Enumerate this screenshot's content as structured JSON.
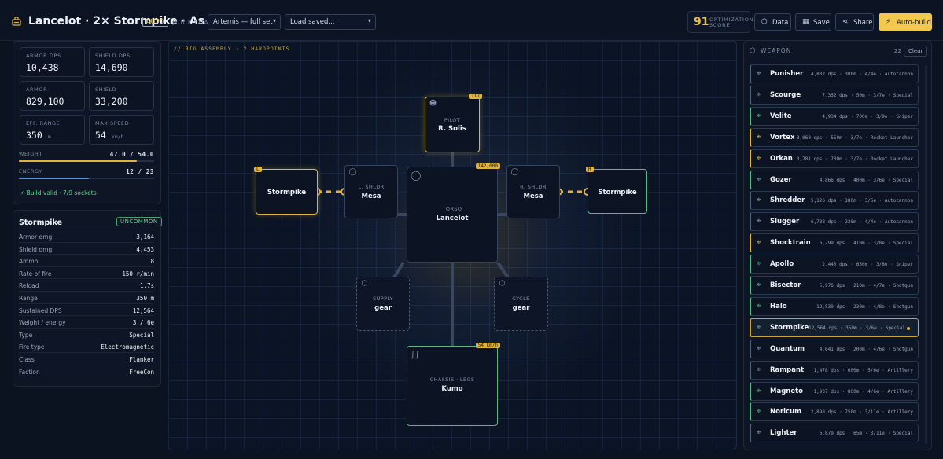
{
  "header": {
    "build_title": "Lancelot · 2× Stormpike · As",
    "auto_label": "AUTO",
    "quick_load_label": "QUICK-LOAD",
    "preset_value": "Artemis — full set",
    "load_placeholder": "Load saved...",
    "score_value": "91",
    "score_label_1": "OPTIMIZATION",
    "score_label_2": "SCORE",
    "data_label": "Data",
    "save_label": "Save",
    "share_label": "Share",
    "autobuild_label": "Auto-build"
  },
  "stats": {
    "armor_dps": {
      "label": "ARMOR DPS",
      "value": "10,438"
    },
    "shield_dps": {
      "label": "SHIELD DPS",
      "value": "14,690"
    },
    "armor": {
      "label": "ARMOR",
      "value": "829,100"
    },
    "shield": {
      "label": "SHIELD",
      "value": "33,200"
    },
    "eff_range": {
      "label": "EFF. RANGE",
      "value": "350",
      "unit": "m"
    },
    "max_speed": {
      "label": "MAX SPEED",
      "value": "54",
      "unit": "km/h"
    },
    "weight": {
      "label": "WEIGHT",
      "value": "47.0 / 54.0",
      "fraction": 0.87
    },
    "energy": {
      "label": "ENERGY",
      "value": "12 / 23",
      "fraction": 0.52
    },
    "build_valid": "Build valid · 7/9 sockets"
  },
  "selected_weapon": {
    "name": "Stormpike",
    "rarity": "UNCOMMON",
    "props": [
      {
        "k": "Armor dmg",
        "v": "3,164"
      },
      {
        "k": "Shield dmg",
        "v": "4,453"
      },
      {
        "k": "Ammo",
        "v": "8"
      },
      {
        "k": "Rate of fire",
        "v": "150 r/min"
      },
      {
        "k": "Reload",
        "v": "1.7s"
      },
      {
        "k": "Range",
        "v": "350 m"
      },
      {
        "k": "Sustained DPS",
        "v": "12,564"
      },
      {
        "k": "Weight / energy",
        "v": "3 / 6e"
      },
      {
        "k": "Type",
        "v": "Special"
      },
      {
        "k": "Fire type",
        "v": "Electromagnetic"
      },
      {
        "k": "Class",
        "v": "Flanker"
      },
      {
        "k": "Faction",
        "v": "FreeCon"
      }
    ]
  },
  "rig": {
    "title": "// RIG ASSEMBLY · 2 HARDPOINTS",
    "pilot": {
      "cat": "PILOT",
      "name": "R. Solis",
      "tag": "117"
    },
    "torso": {
      "cat": "TORSO",
      "name": "Lancelot",
      "tag": "142,000"
    },
    "l_shldr": {
      "cat": "L. SHLDR",
      "name": "Mesa"
    },
    "r_shldr": {
      "cat": "R. SHLDR",
      "name": "Mesa"
    },
    "left_weapon": {
      "name": "Stormpike",
      "tag": "L"
    },
    "right_weapon": {
      "name": "Stormpike",
      "tag": "R"
    },
    "supply": {
      "cat": "SUPPLY",
      "name": "gear"
    },
    "cycle": {
      "cat": "CYCLE",
      "name": "gear"
    },
    "chassis": {
      "cat": "CHASSIS · LEGS",
      "name": "Kumo",
      "tag": "54 km/h"
    }
  },
  "weapon_panel": {
    "title": "WEAPON",
    "count": "22",
    "clear_label": "Clear",
    "items": [
      {
        "name": "Punisher",
        "meta": "4,832 dps · 300m · 4/4e · Autocannon",
        "tier": "grey"
      },
      {
        "name": "Scourge",
        "meta": "7,352 dps · 50m · 3/7e · Special",
        "tier": "grey"
      },
      {
        "name": "Velite",
        "meta": "4,934 dps · 700m · 3/9e · Sniper",
        "tier": "green"
      },
      {
        "name": "Vortex",
        "meta": "3,060 dps · 550m · 3/7e · Rocket Launcher",
        "tier": "gold"
      },
      {
        "name": "Orkan",
        "meta": "3,781 dps · 700m · 3/7e · Rocket Launcher",
        "tier": "gold"
      },
      {
        "name": "Gozer",
        "meta": "4,866 dps · 400m · 3/6e · Special",
        "tier": "green"
      },
      {
        "name": "Shredder",
        "meta": "5,126 dps · 180m · 3/6e · Autocannon",
        "tier": "grey"
      },
      {
        "name": "Slugger",
        "meta": "6,738 dps · 220m · 4/4e · Autocannon",
        "tier": "grey"
      },
      {
        "name": "Shocktrain",
        "meta": "6,799 dps · 410m · 3/8e · Special",
        "tier": "gold"
      },
      {
        "name": "Apollo",
        "meta": "2,440 dps · 650m · 3/8e · Sniper",
        "tier": "green"
      },
      {
        "name": "Bisector",
        "meta": "5,976 dps · 210m · 4/7e · Shotgun",
        "tier": "green"
      },
      {
        "name": "Halo",
        "meta": "12,539 dps · 230m · 4/8e · Shotgun",
        "tier": "green"
      },
      {
        "name": "Stormpike",
        "meta": "12,564 dps · 350m · 3/6e · Special",
        "tier": "green",
        "selected": true
      },
      {
        "name": "Quantum",
        "meta": "4,641 dps · 200m · 4/6e · Shotgun",
        "tier": "grey"
      },
      {
        "name": "Rampant",
        "meta": "1,478 dps · 600m · 5/6e · Artillery",
        "tier": "grey"
      },
      {
        "name": "Magneto",
        "meta": "1,937 dps · 800m · 4/6e · Artillery",
        "tier": "green"
      },
      {
        "name": "Noricum",
        "meta": "2,898 dps · 750m · 3/11e · Artillery",
        "tier": "green"
      },
      {
        "name": "Lighter",
        "meta": "6,879 dps · 65m · 3/11e · Special",
        "tier": "grey"
      }
    ]
  }
}
